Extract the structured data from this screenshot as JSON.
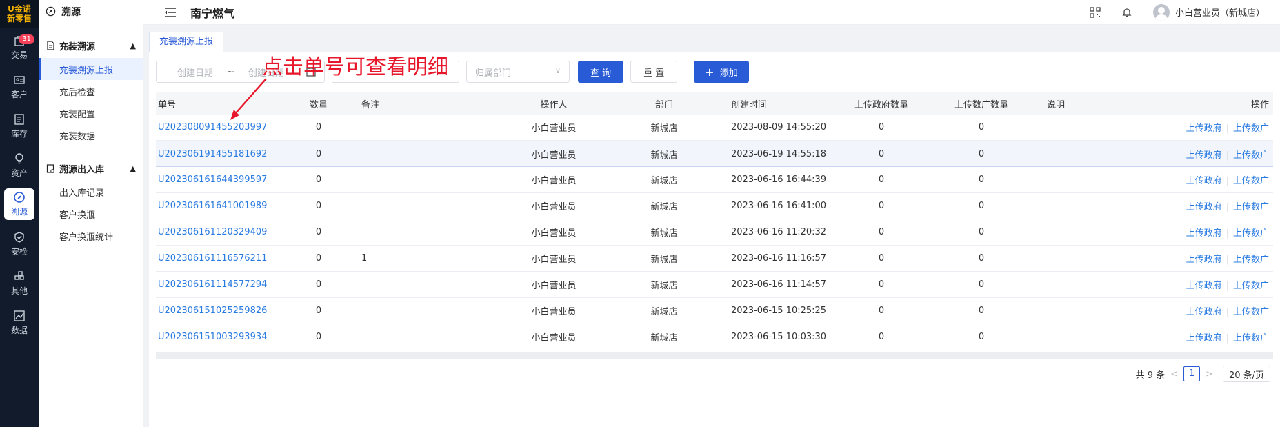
{
  "brand": {
    "line1": "金诺",
    "line2": "新零售",
    "mark": "U"
  },
  "rail": [
    {
      "label": "交易",
      "badge": "31"
    },
    {
      "label": "客户"
    },
    {
      "label": "库存"
    },
    {
      "label": "资产"
    },
    {
      "label": "溯源"
    },
    {
      "label": "安检"
    },
    {
      "label": "其他"
    },
    {
      "label": "数据"
    }
  ],
  "side": {
    "head": "溯源",
    "groups": [
      {
        "label": "充装溯源",
        "items": [
          "充装溯源上报",
          "充后检查",
          "充装配置",
          "充装数据"
        ]
      },
      {
        "label": "溯源出入库",
        "items": [
          "出入库记录",
          "客户换瓶",
          "客户换瓶统计"
        ]
      }
    ]
  },
  "header": {
    "title": "南宁燃气",
    "user": "小白营业员（新城店）"
  },
  "tab": "充装溯源上报",
  "filters": {
    "start_placeholder": "创建日期",
    "tilde": "~",
    "end_placeholder": "创建日期",
    "dept_placeholder": "归属部门",
    "query": "查 询",
    "reset": "重 置",
    "add": "添加"
  },
  "annotation": "点击单号可查看明细",
  "table": {
    "headers": [
      "单号",
      "数量",
      "备注",
      "操作人",
      "部门",
      "创建时间",
      "上传政府数量",
      "上传数广数量",
      "说明",
      "操作"
    ],
    "action_gov": "上传政府",
    "action_sg": "上传数广",
    "rows": [
      {
        "no": "U202308091455203997",
        "qty": "0",
        "note": "",
        "op": "小白营业员",
        "dept": "新城店",
        "time": "2023-08-09 14:55:20",
        "gov": "0",
        "sg": "0",
        "desc": ""
      },
      {
        "no": "U202306191455181692",
        "qty": "0",
        "note": "",
        "op": "小白营业员",
        "dept": "新城店",
        "time": "2023-06-19 14:55:18",
        "gov": "0",
        "sg": "0",
        "desc": ""
      },
      {
        "no": "U202306161644399597",
        "qty": "0",
        "note": "",
        "op": "小白营业员",
        "dept": "新城店",
        "time": "2023-06-16 16:44:39",
        "gov": "0",
        "sg": "0",
        "desc": ""
      },
      {
        "no": "U202306161641001989",
        "qty": "0",
        "note": "",
        "op": "小白营业员",
        "dept": "新城店",
        "time": "2023-06-16 16:41:00",
        "gov": "0",
        "sg": "0",
        "desc": ""
      },
      {
        "no": "U202306161120329409",
        "qty": "0",
        "note": "",
        "op": "小白营业员",
        "dept": "新城店",
        "time": "2023-06-16 11:20:32",
        "gov": "0",
        "sg": "0",
        "desc": ""
      },
      {
        "no": "U202306161116576211",
        "qty": "0",
        "note": "1",
        "op": "小白营业员",
        "dept": "新城店",
        "time": "2023-06-16 11:16:57",
        "gov": "0",
        "sg": "0",
        "desc": ""
      },
      {
        "no": "U202306161114577294",
        "qty": "0",
        "note": "",
        "op": "小白营业员",
        "dept": "新城店",
        "time": "2023-06-16 11:14:57",
        "gov": "0",
        "sg": "0",
        "desc": ""
      },
      {
        "no": "U202306151025259826",
        "qty": "0",
        "note": "",
        "op": "小白营业员",
        "dept": "新城店",
        "time": "2023-06-15 10:25:25",
        "gov": "0",
        "sg": "0",
        "desc": ""
      },
      {
        "no": "U202306151003293934",
        "qty": "0",
        "note": "",
        "op": "小白营业员",
        "dept": "新城店",
        "time": "2023-06-15 10:03:30",
        "gov": "0",
        "sg": "0",
        "desc": ""
      }
    ]
  },
  "pager": {
    "total": "共 9 条",
    "prev": "<",
    "page": "1",
    "next": ">",
    "size": "20 条/页"
  }
}
